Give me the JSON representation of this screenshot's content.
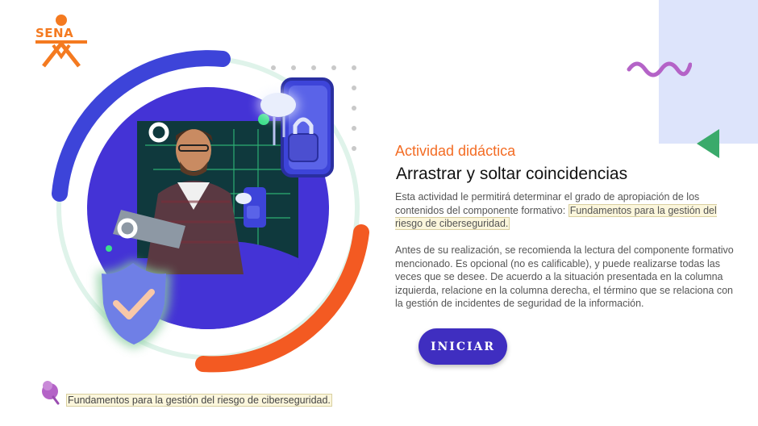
{
  "logo": {
    "text": "SENA",
    "icon": "sena-logo-icon"
  },
  "activity": {
    "subtitle": "Actividad didáctica",
    "title": "Arrastrar y soltar coincidencias",
    "para1_before": "Esta actividad le permitirá determinar el grado de apropiación de los contenidos del componente formativo: ",
    "para1_highlight": "Fundamentos para la gestión del riesgo de ciberseguridad.",
    "para2": "Antes de su realización, se recomienda la lectura del componente formativo mencionado.  Es opcional (no es calificable), y puede realizarse todas las veces que se desee.  De acuerdo a la situación presentada en la columna izquierda, relacione en la columna derecha, el término que se relaciona con la gestión de incidentes de seguridad de la información.",
    "start_button": "INICIAR"
  },
  "footer": {
    "icon": "pin-icon",
    "text": "Fundamentos para la gestión del riesgo de ciberseguridad."
  },
  "colors": {
    "orange": "#f36c24",
    "purple": "#3f2ec0",
    "panel": "#dde4fb",
    "green": "#3aaa6b",
    "wave": "#b463c7"
  }
}
